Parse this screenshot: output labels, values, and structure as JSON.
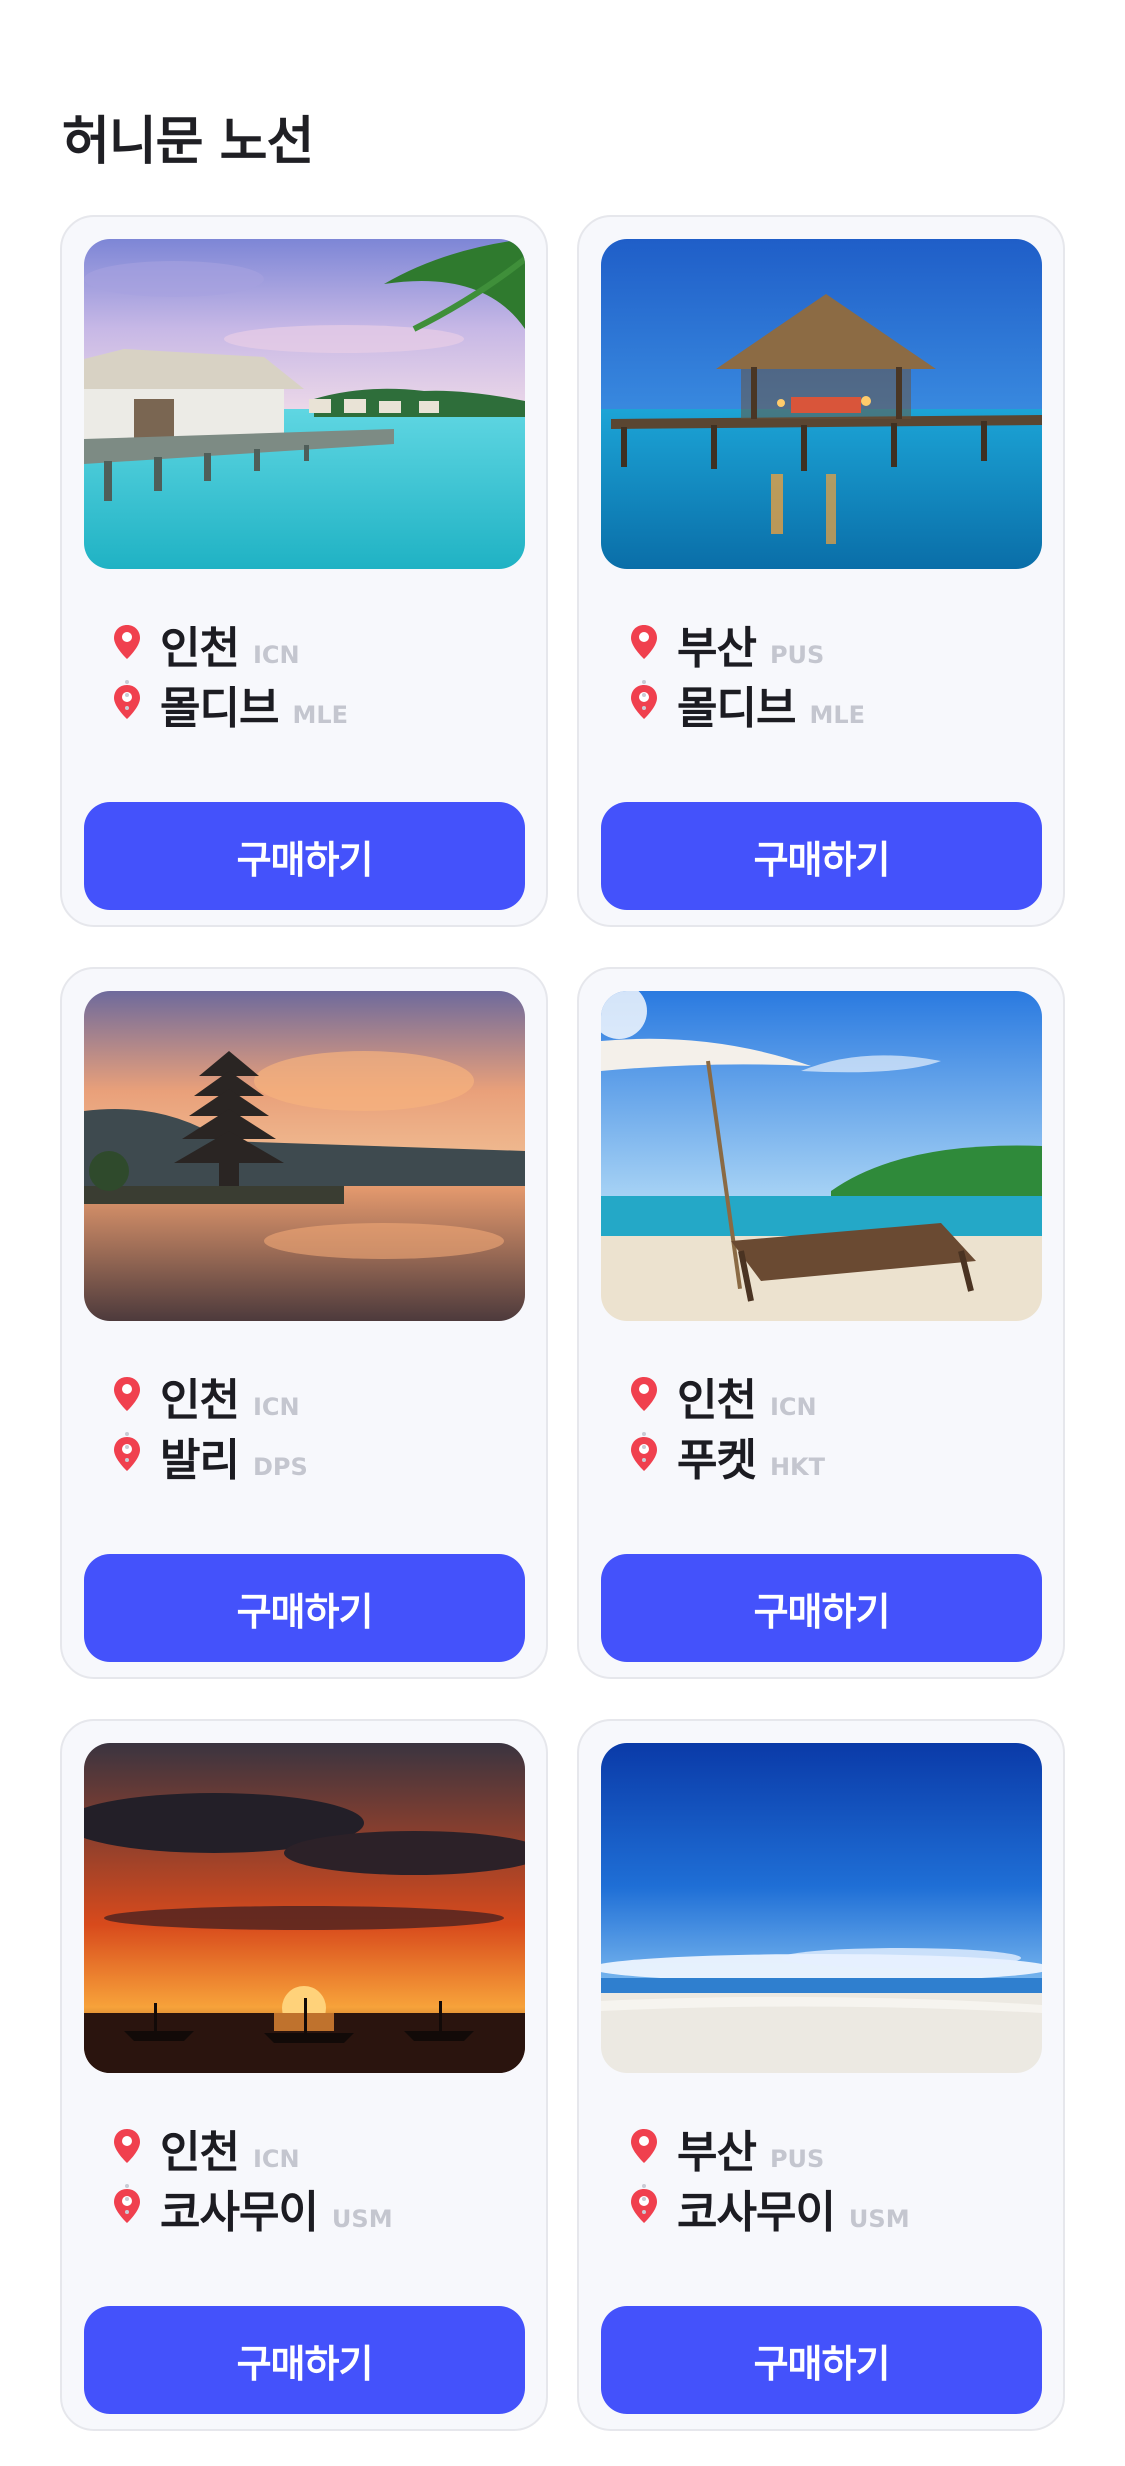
{
  "page": {
    "title": "허니문 노선"
  },
  "routes": [
    {
      "from": {
        "city": "인천",
        "code": "ICN"
      },
      "to": {
        "city": "몰디브",
        "code": "MLE"
      },
      "button": "구매하기",
      "image": "maldives-overwater-villas-photo"
    },
    {
      "from": {
        "city": "부산",
        "code": "PUS"
      },
      "to": {
        "city": "몰디브",
        "code": "MLE"
      },
      "button": "구매하기",
      "image": "maldives-pier-gazebo-photo"
    },
    {
      "from": {
        "city": "인천",
        "code": "ICN"
      },
      "to": {
        "city": "발리",
        "code": "DPS"
      },
      "button": "구매하기",
      "image": "bali-temple-sunset-photo"
    },
    {
      "from": {
        "city": "인천",
        "code": "ICN"
      },
      "to": {
        "city": "푸켓",
        "code": "HKT"
      },
      "button": "구매하기",
      "image": "phuket-beach-loungers-photo"
    },
    {
      "from": {
        "city": "인천",
        "code": "ICN"
      },
      "to": {
        "city": "코사무이",
        "code": "USM"
      },
      "button": "구매하기",
      "image": "koh-samui-sunset-boats-photo"
    },
    {
      "from": {
        "city": "부산",
        "code": "PUS"
      },
      "to": {
        "city": "코사무이",
        "code": "USM"
      },
      "button": "구매하기",
      "image": "koh-samui-white-beach-photo"
    }
  ],
  "icons": {
    "pin": "location-pin-icon"
  },
  "colors": {
    "accent": "#4452fb",
    "pin": "#f0404e",
    "card_bg": "#f7f8fc",
    "code_text": "#c4c6cf"
  }
}
